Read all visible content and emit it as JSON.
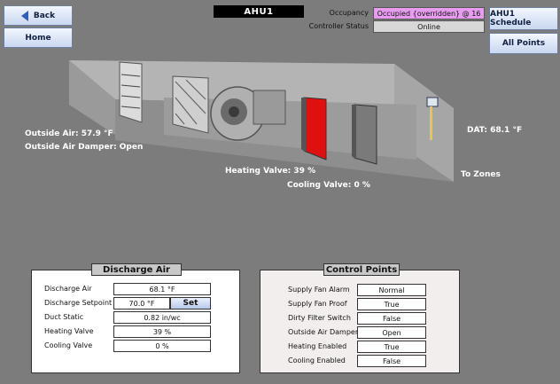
{
  "nav": {
    "back": "Back",
    "home": "Home",
    "schedule": "AHU1 Schedule",
    "all_points": "All Points"
  },
  "title": "AHU1",
  "header": {
    "occupancy_label": "Occupancy",
    "occupancy_value": "Occupied {overridden} @ 16",
    "status_label": "Controller Status",
    "status_value": "Online"
  },
  "overlays": {
    "outside_air": "Outside Air: 57.9 °F",
    "outside_damper": "Outside Air Damper: Open",
    "heating_valve": "Heating Valve: 39 %",
    "cooling_valve": "Cooling Valve: 0 %",
    "dat": "DAT: 68.1 °F",
    "to_zones": "To Zones"
  },
  "discharge": {
    "title": "Discharge Air",
    "rows": [
      {
        "label": "Discharge Air",
        "value": "68.1 °F"
      },
      {
        "label": "Discharge Setpoint",
        "value": "70.0 °F",
        "button": "Set"
      },
      {
        "label": "Duct Static",
        "value": "0.82 in/wc"
      },
      {
        "label": "Heating Valve",
        "value": "39 %"
      },
      {
        "label": "Cooling Valve",
        "value": "0 %"
      }
    ]
  },
  "control": {
    "title": "Control Points",
    "rows": [
      {
        "label": "Supply Fan Alarm",
        "value": "Normal"
      },
      {
        "label": "Supply Fan Proof",
        "value": "True"
      },
      {
        "label": "Dirty Filter Switch",
        "value": "False"
      },
      {
        "label": "Outside Air Damper",
        "value": "Open"
      },
      {
        "label": "Heating Enabled",
        "value": "True"
      },
      {
        "label": "Cooling Enabled",
        "value": "False"
      }
    ]
  },
  "colors": {
    "occupancy_bg": "#e89cf0",
    "status_bg": "#d8d8d8",
    "heat_coil": "#e01010"
  },
  "icons": {
    "back": "back-arrow-icon"
  }
}
